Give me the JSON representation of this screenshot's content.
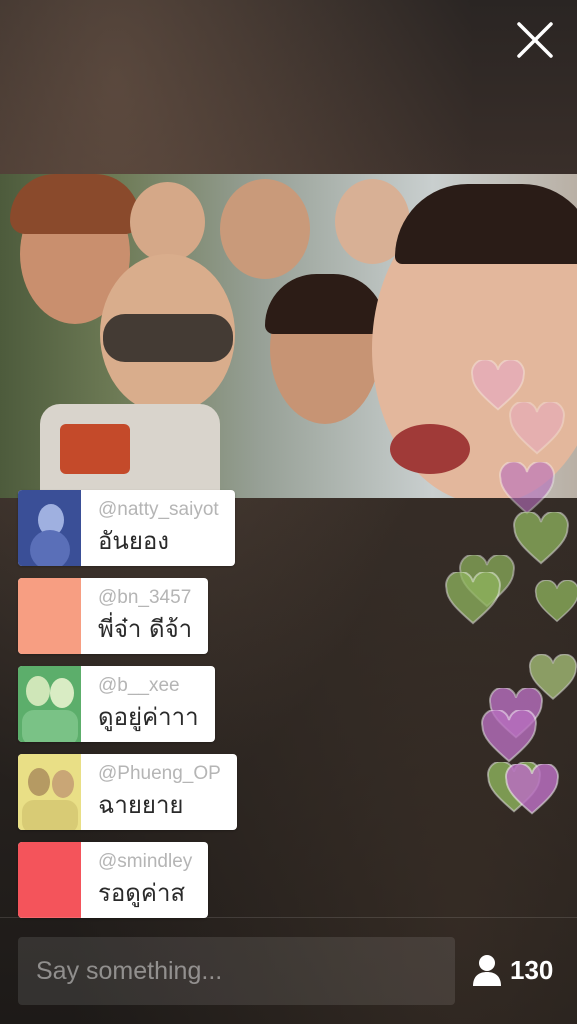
{
  "comments": [
    {
      "username": "@natty_saiyot",
      "message": "อันยอง",
      "avatar_color": "#3a4f97"
    },
    {
      "username": "@bn_3457",
      "message": "พี่จ๋า ดีจ้า",
      "avatar_color": "#f79e82"
    },
    {
      "username": "@b__xee",
      "message": "ดูอยู่ค่าาา",
      "avatar_color": "#5cae6b"
    },
    {
      "username": "@Phueng_OP",
      "message": "ฉายยาย",
      "avatar_color": "#e9df86"
    },
    {
      "username": "@smindley",
      "message": "รอดูค่าส",
      "avatar_color": "#f4545b"
    }
  ],
  "composer": {
    "placeholder": "Say something..."
  },
  "viewer_count": "130",
  "heart_colors": [
    "#e8a7c8",
    "#b86fc0",
    "#8fb55e",
    "#a9c47a"
  ]
}
